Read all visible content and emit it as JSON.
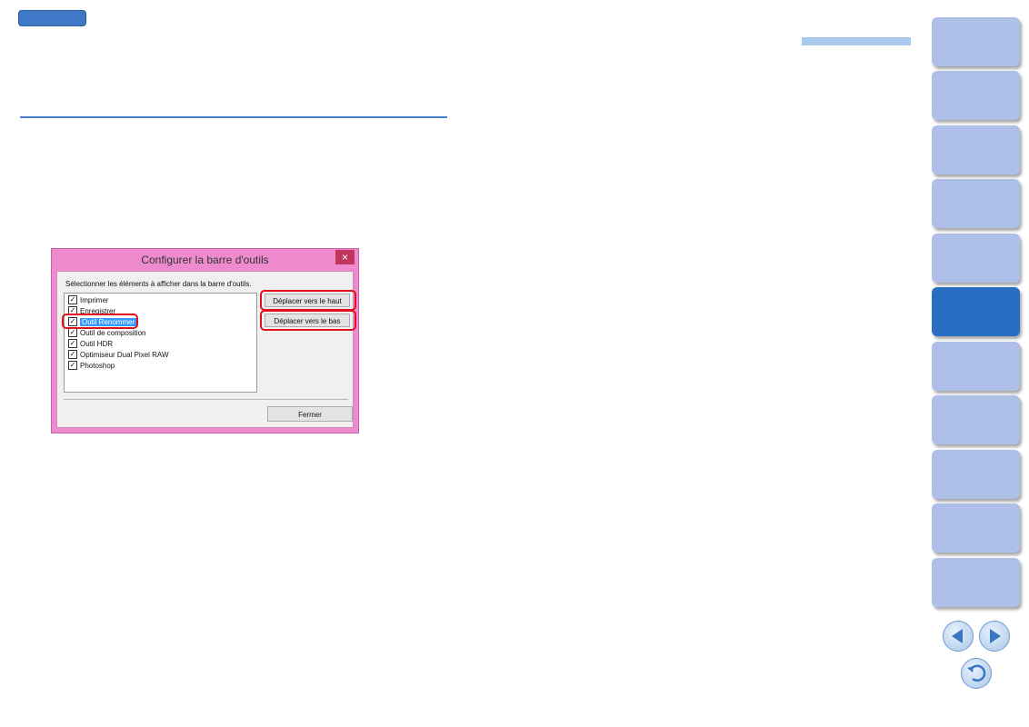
{
  "dialog": {
    "title": "Configurer la barre d'outils",
    "close_glyph": "×",
    "instruction": "Sélectionner les éléments à afficher dans la barre d'outils.",
    "items": [
      {
        "label": "Imprimer",
        "checked": true,
        "selected": false
      },
      {
        "label": "Enregistrer",
        "checked": true,
        "selected": false
      },
      {
        "label": "Outil Renommer",
        "checked": true,
        "selected": true
      },
      {
        "label": "Outil de composition",
        "checked": true,
        "selected": false
      },
      {
        "label": "Outil HDR",
        "checked": true,
        "selected": false
      },
      {
        "label": "Optimiseur Dual Pixel RAW",
        "checked": true,
        "selected": false
      },
      {
        "label": "Photoshop",
        "checked": true,
        "selected": false
      }
    ],
    "move_up_label": "Déplacer vers le haut",
    "move_down_label": "Déplacer vers le bas",
    "close_label": "Fermer",
    "check_glyph": "✓"
  },
  "nav": {
    "active_index": 5,
    "tab_count": 11,
    "prev_icon": "prev-page-icon",
    "next_icon": "next-page-icon",
    "return_icon": "return-icon"
  },
  "colors": {
    "accent": "#2a6ec3",
    "tab": "#aebfe8",
    "highlight": "#e0101e",
    "dialog_frame": "#ee8bcf"
  }
}
